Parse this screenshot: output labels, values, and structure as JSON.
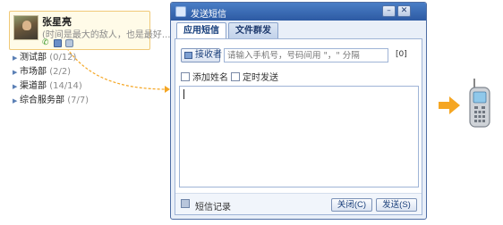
{
  "contact": {
    "name": "张星亮",
    "status": "(时间是最大的敌人，也是最好..."
  },
  "groups": [
    {
      "label": "测试部",
      "count": "(0/12)"
    },
    {
      "label": "市场部",
      "count": "(2/2)"
    },
    {
      "label": "渠道部",
      "count": "(14/14)"
    },
    {
      "label": "综合服务部",
      "count": "(7/7)"
    }
  ],
  "dialog": {
    "title": "发送短信",
    "tabs": [
      "应用短信",
      "文件群发"
    ],
    "recipient_button": "接收者",
    "recipient_placeholder": "请输入手机号，号码间用 \"，\" 分隔",
    "char_count": "[0]",
    "options": {
      "add_name": "添加姓名",
      "timed_send": "定时发送"
    },
    "history_link": "短信记录",
    "close_button": "关闭(C)",
    "send_button": "发送(S)"
  },
  "colors": {
    "accent_orange": "#f5a623",
    "titlebar": "#2d5aa3"
  }
}
